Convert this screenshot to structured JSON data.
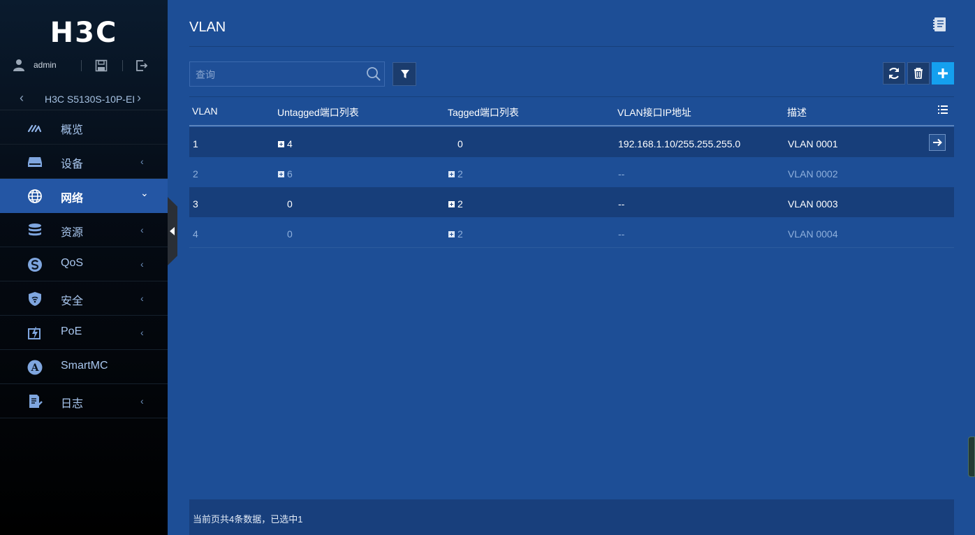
{
  "brand": {
    "logo": "H3C"
  },
  "user": {
    "name": "admin"
  },
  "device": {
    "name": "H3C S5130S-10P-EI"
  },
  "nav": {
    "items": [
      {
        "label": "概览",
        "icon": "gauge-icon",
        "has_chevron": false
      },
      {
        "label": "设备",
        "icon": "device-icon",
        "has_chevron": true,
        "chevron": "‹"
      },
      {
        "label": "网络",
        "icon": "globe-icon",
        "has_chevron": true,
        "chevron": "⌄",
        "active": true
      },
      {
        "label": "资源",
        "icon": "database-icon",
        "has_chevron": true,
        "chevron": "‹"
      },
      {
        "label": "QoS",
        "icon": "qos-icon",
        "has_chevron": true,
        "chevron": "‹"
      },
      {
        "label": "安全",
        "icon": "shield-icon",
        "has_chevron": true,
        "chevron": "‹"
      },
      {
        "label": "PoE",
        "icon": "poe-icon",
        "has_chevron": true,
        "chevron": "‹"
      },
      {
        "label": "SmartMC",
        "icon": "smartmc-icon",
        "has_chevron": false
      },
      {
        "label": "日志",
        "icon": "log-icon",
        "has_chevron": true,
        "chevron": "‹"
      }
    ]
  },
  "page": {
    "title": "VLAN"
  },
  "search": {
    "placeholder": "查询"
  },
  "table": {
    "columns": [
      "VLAN",
      "Untagged端口列表",
      "Tagged端口列表",
      "VLAN接口IP地址",
      "描述"
    ],
    "rows": [
      {
        "vlan": "1",
        "untagged": "4",
        "untagged_expand": true,
        "tagged": "0",
        "tagged_expand": false,
        "ip": "192.168.1.10/255.255.255.0",
        "desc": "VLAN 0001",
        "selected": true
      },
      {
        "vlan": "2",
        "untagged": "6",
        "untagged_expand": true,
        "tagged": "2",
        "tagged_expand": true,
        "ip": "--",
        "desc": "VLAN 0002"
      },
      {
        "vlan": "3",
        "untagged": "0",
        "untagged_expand": false,
        "tagged": "2",
        "tagged_expand": true,
        "ip": "--",
        "desc": "VLAN 0003",
        "alt": true
      },
      {
        "vlan": "4",
        "untagged": "0",
        "untagged_expand": false,
        "tagged": "2",
        "tagged_expand": true,
        "ip": "--",
        "desc": "VLAN 0004"
      }
    ]
  },
  "footer": {
    "text": "当前页共4条数据，已选中1"
  },
  "colors": {
    "background": "#1d4e96",
    "sidebar": "#000000",
    "active_nav": "#2456a4",
    "accent": "#14a0ef"
  }
}
